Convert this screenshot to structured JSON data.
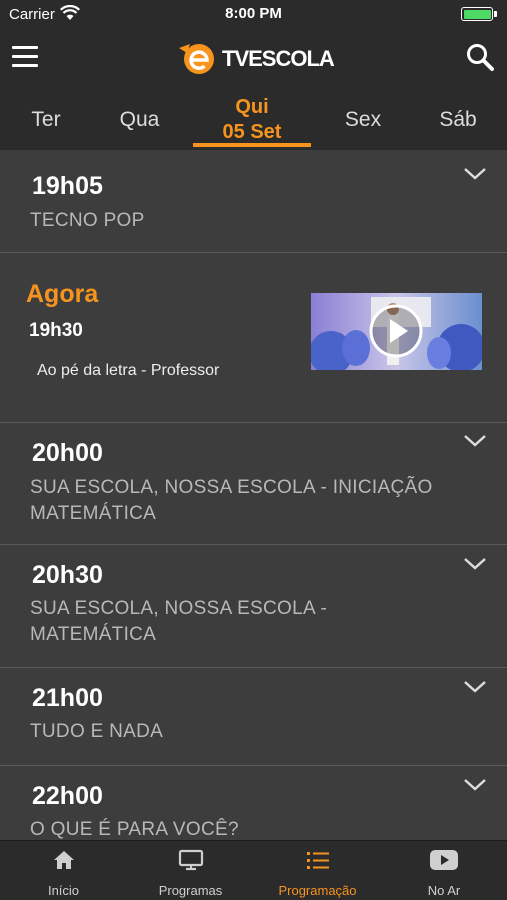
{
  "status_bar": {
    "carrier": "Carrier",
    "time": "8:00 PM",
    "battery_level": 1.0,
    "battery_color": "#4cd964"
  },
  "header": {
    "menu_icon": "hamburger-menu-icon",
    "logo_text": "TVESCOLA",
    "search_icon": "search-icon",
    "accent_color": "#f7941d"
  },
  "day_tabs": [
    {
      "label": "Ter"
    },
    {
      "label": "Qua"
    },
    {
      "label": "Qui",
      "date": "05 Set",
      "active": true
    },
    {
      "label": "Sex"
    },
    {
      "label": "Sáb"
    }
  ],
  "schedule": {
    "items": [
      {
        "time": "19h05",
        "title": "TECNO POP"
      },
      {
        "now_label": "Agora",
        "time": "19h30",
        "title": "Ao pé da letra - Professor"
      },
      {
        "time": "20h00",
        "title": "SUA ESCOLA, NOSSA ESCOLA - INICIAÇÃO MATEMÁTICA"
      },
      {
        "time": "20h30",
        "title": "SUA ESCOLA, NOSSA ESCOLA - MATEMÁTICA"
      },
      {
        "time": "21h00",
        "title": "TUDO E NADA"
      },
      {
        "time": "22h00",
        "title": "O QUE É PARA VOCÊ?"
      }
    ]
  },
  "tab_bar": [
    {
      "label": "Início",
      "icon": "home-icon"
    },
    {
      "label": "Programas",
      "icon": "tv-icon"
    },
    {
      "label": "Programação",
      "icon": "list-icon",
      "active": true
    },
    {
      "label": "No Ar",
      "icon": "play-video-icon"
    }
  ]
}
